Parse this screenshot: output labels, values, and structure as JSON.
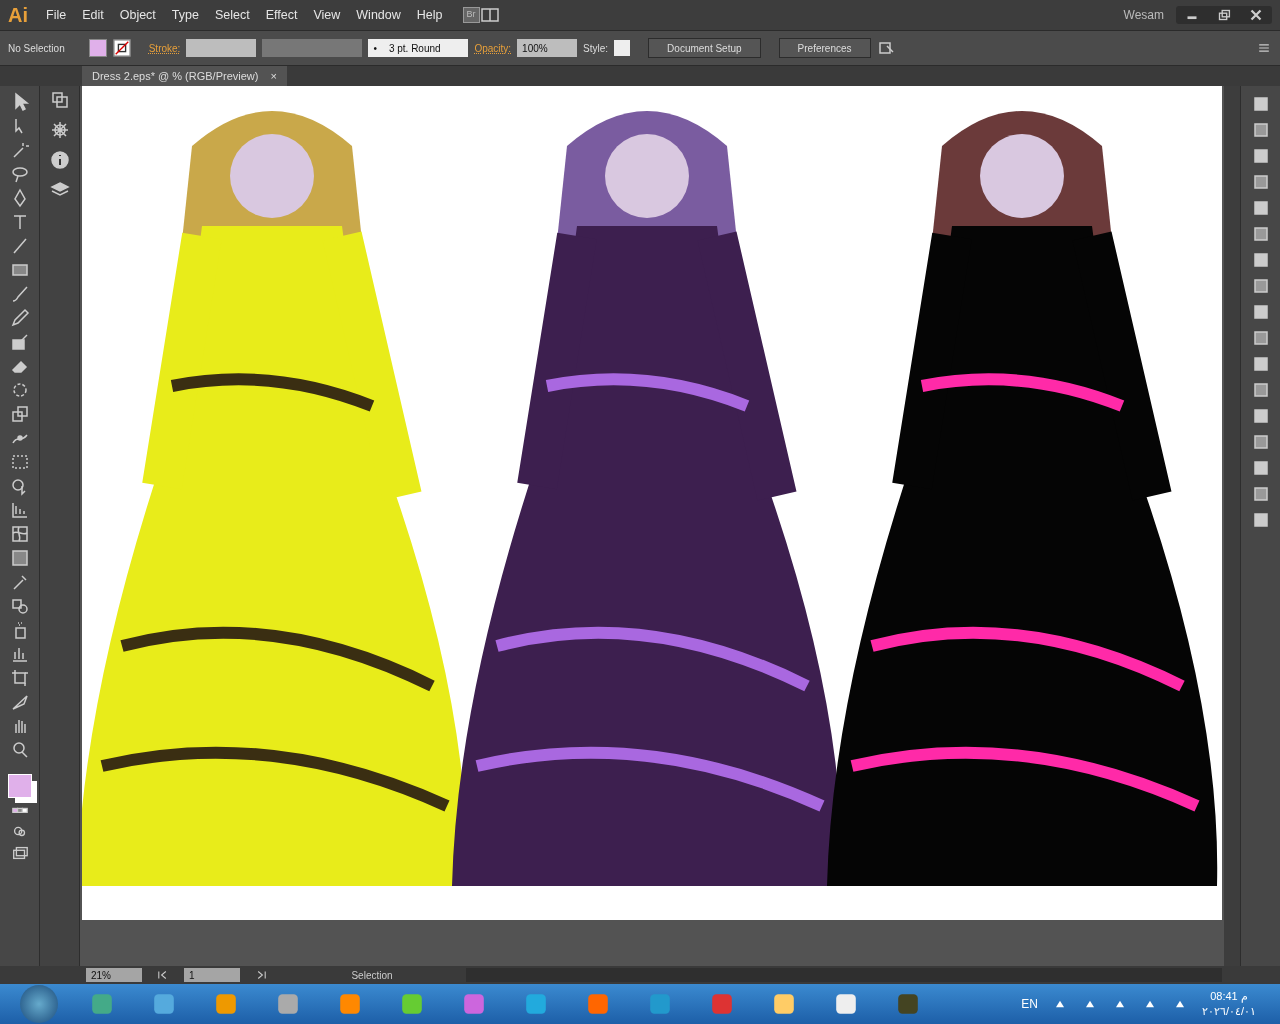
{
  "app": {
    "logo": "Ai",
    "menu": [
      "File",
      "Edit",
      "Object",
      "Type",
      "Select",
      "Effect",
      "View",
      "Window",
      "Help"
    ],
    "bridge": "Br",
    "user": "Wesam"
  },
  "control_bar": {
    "selection": "No Selection",
    "stroke_label": "Stroke:",
    "brush_marker": "•",
    "brush": "3 pt. Round",
    "opacity_label": "Opacity:",
    "opacity": "100%",
    "style_label": "Style:",
    "buttons": [
      "Document Setup",
      "Preferences"
    ]
  },
  "tabs": [
    {
      "label": "Dress 2.eps* @ % (RGB/Preview)",
      "close": "×",
      "selected": true
    }
  ],
  "status_bar": {
    "zoom": "21%",
    "artboard": "1",
    "tool": "Selection"
  },
  "taskbar": {
    "language": "EN",
    "time": "08:41 م",
    "date": "٢٠٢٦/٠٤/٠١"
  }
}
